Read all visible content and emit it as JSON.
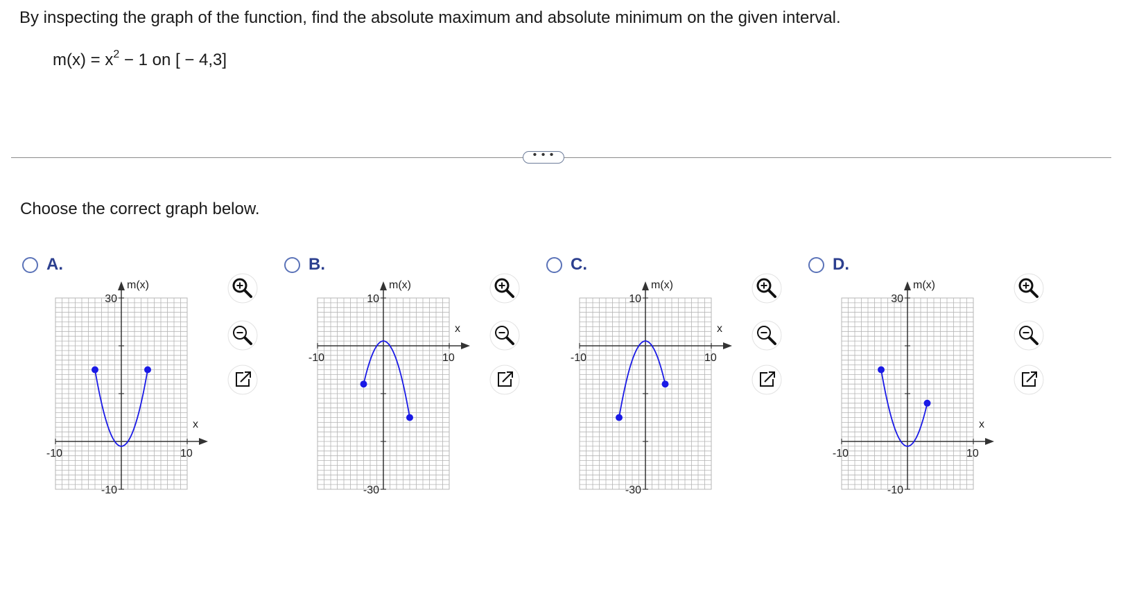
{
  "question": {
    "text": "By inspecting the graph of the function, find the absolute maximum and absolute minimum on the given interval.",
    "formula_left": "m(x) = x",
    "formula_exp": "2",
    "formula_right": " − 1 on [ − 4,3]"
  },
  "more_button": "• • •",
  "prompt": "Choose the correct graph below.",
  "options": [
    {
      "letter": "A.",
      "selected": false,
      "xlabel": "x",
      "ylabel": "m(x)",
      "x_min_label": "-10",
      "x_max_label": "10",
      "y_max_label": "30",
      "y_min_label": "-10"
    },
    {
      "letter": "B.",
      "selected": false,
      "xlabel": "x",
      "ylabel": "m(x)",
      "x_min_label": "-10",
      "x_max_label": "10",
      "y_max_label": "10",
      "y_min_label": "-30"
    },
    {
      "letter": "C.",
      "selected": false,
      "xlabel": "x",
      "ylabel": "m(x)",
      "x_min_label": "-10",
      "x_max_label": "10",
      "y_max_label": "10",
      "y_min_label": "-30"
    },
    {
      "letter": "D.",
      "selected": false,
      "xlabel": "x",
      "ylabel": "m(x)",
      "x_min_label": "-10",
      "x_max_label": "10",
      "y_max_label": "30",
      "y_min_label": "-10"
    }
  ],
  "tools": [
    "zoom-in-icon",
    "zoom-out-icon",
    "open-new-window-icon"
  ],
  "colors": {
    "curve": "#1a1ae6",
    "grid": "#b4b4b4",
    "axis": "#333333",
    "radio": "#5b73b8",
    "letter": "#2c3f8f"
  },
  "chart_data": [
    {
      "type": "line",
      "xlim": [
        -10,
        10
      ],
      "ylim": [
        -10,
        30
      ],
      "grid": true,
      "x": [
        -4,
        -3,
        -2,
        -1,
        0,
        1,
        2,
        3,
        4
      ],
      "y": [
        15,
        8,
        3,
        0,
        -1,
        0,
        3,
        8,
        15
      ],
      "endpoints": [
        [
          -4,
          15
        ],
        [
          4,
          15
        ]
      ]
    },
    {
      "type": "line",
      "xlim": [
        -10,
        10
      ],
      "ylim": [
        -30,
        10
      ],
      "grid": true,
      "x": [
        -3,
        -2,
        -1,
        0,
        1,
        2,
        3,
        4
      ],
      "y": [
        -8,
        -3,
        0,
        1,
        0,
        -3,
        -8,
        -15
      ],
      "endpoints": [
        [
          -3,
          -8
        ],
        [
          4,
          -15
        ]
      ]
    },
    {
      "type": "line",
      "xlim": [
        -10,
        10
      ],
      "ylim": [
        -30,
        10
      ],
      "grid": true,
      "x": [
        -4,
        -3,
        -2,
        -1,
        0,
        1,
        2,
        3
      ],
      "y": [
        -15,
        -8,
        -3,
        0,
        1,
        0,
        -3,
        -8
      ],
      "endpoints": [
        [
          -4,
          -15
        ],
        [
          3,
          -8
        ]
      ]
    },
    {
      "type": "line",
      "xlim": [
        -10,
        10
      ],
      "ylim": [
        -10,
        30
      ],
      "grid": true,
      "x": [
        -4,
        -3,
        -2,
        -1,
        0,
        1,
        2,
        3
      ],
      "y": [
        15,
        8,
        3,
        0,
        -1,
        0,
        3,
        8
      ],
      "endpoints": [
        [
          -4,
          15
        ],
        [
          3,
          8
        ]
      ]
    }
  ]
}
